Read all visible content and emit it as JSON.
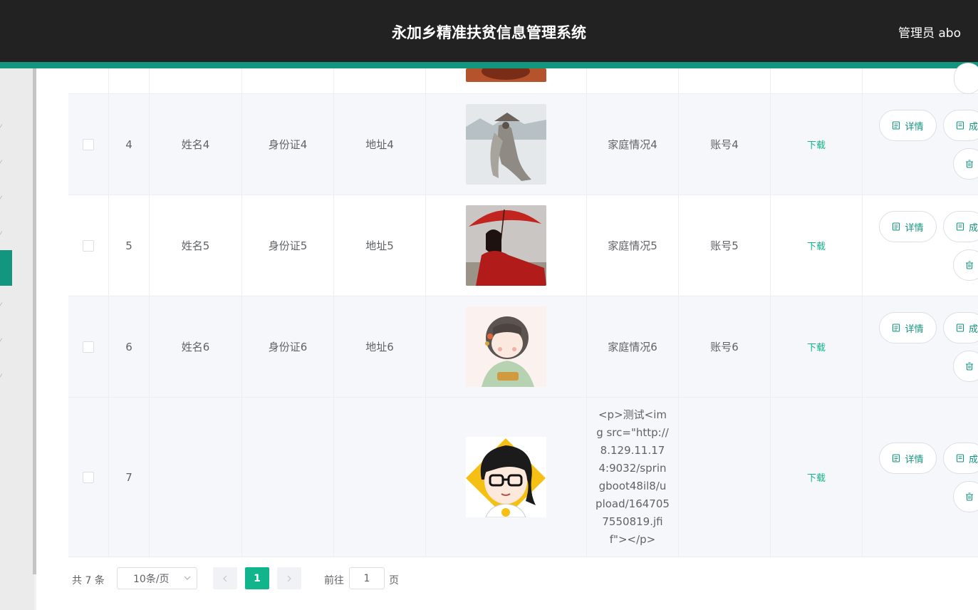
{
  "header": {
    "title": "永加乡精准扶贫信息管理系统",
    "user": "管理员 abo"
  },
  "table": {
    "rows": [
      {
        "id": "4",
        "name": "姓名4",
        "idcard": "身份证4",
        "address": "地址4",
        "family": "家庭情况4",
        "account": "账号4",
        "download": "下载",
        "detail": "详情",
        "result": "成",
        "image": "ink-painting-figure"
      },
      {
        "id": "5",
        "name": "姓名5",
        "idcard": "身份证5",
        "address": "地址5",
        "family": "家庭情况5",
        "account": "账号5",
        "download": "下载",
        "detail": "详情",
        "result": "成",
        "image": "red-umbrella-girl"
      },
      {
        "id": "6",
        "name": "姓名6",
        "idcard": "身份证6",
        "address": "地址6",
        "family": "家庭情况6",
        "account": "账号6",
        "download": "下载",
        "detail": "详情",
        "result": "成",
        "image": "cartoon-girl-flowers"
      },
      {
        "id": "7",
        "name": "",
        "idcard": "",
        "address": "",
        "family": "<p>测试<img src=\"http://8.129.11.174:9032/springboot48il8/upload/1647057550819.jfif\"></p>",
        "account": "",
        "download": "下载",
        "detail": "详情",
        "result": "成",
        "image": "cartoon-glasses-avatar"
      }
    ]
  },
  "pagination": {
    "total": "共 7 条",
    "page_size": "10条/页",
    "current_page": "1",
    "goto_label": "前往",
    "goto_value": "1",
    "page_suffix": "页"
  },
  "colors": {
    "accent": "#12967f",
    "accent_light": "#12b48c",
    "topbar": "#222222"
  }
}
